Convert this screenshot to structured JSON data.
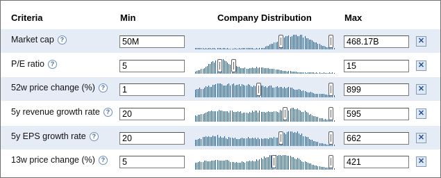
{
  "headers": {
    "criteria": "Criteria",
    "min": "Min",
    "distribution": "Company Distribution",
    "max": "Max"
  },
  "help_glyph": "?",
  "remove_glyph": "✕",
  "rows": [
    {
      "label": "Market cap",
      "min": "50M",
      "max": "468.17B",
      "shape": "market_cap",
      "handle_min_pct": 0.6,
      "handle_max_pct": 0.96
    },
    {
      "label": "P/E ratio",
      "min": "5",
      "max": "15",
      "shape": "pe",
      "handle_min_pct": 0.16,
      "handle_max_pct": 0.26
    },
    {
      "label": "52w price change (%)",
      "min": "1",
      "max": "899",
      "shape": "p52",
      "handle_min_pct": 0.44,
      "handle_max_pct": 0.96
    },
    {
      "label": "5y revenue growth rate",
      "min": "20",
      "max": "595",
      "shape": "rev5",
      "handle_min_pct": 0.63,
      "handle_max_pct": 0.96
    },
    {
      "label": "5y EPS growth rate",
      "min": "20",
      "max": "662",
      "shape": "eps5",
      "handle_min_pct": 0.6,
      "handle_max_pct": 0.96
    },
    {
      "label": "13w price change (%)",
      "min": "5",
      "max": "421",
      "shape": "p13",
      "handle_min_pct": 0.55,
      "handle_max_pct": 0.96
    }
  ]
}
